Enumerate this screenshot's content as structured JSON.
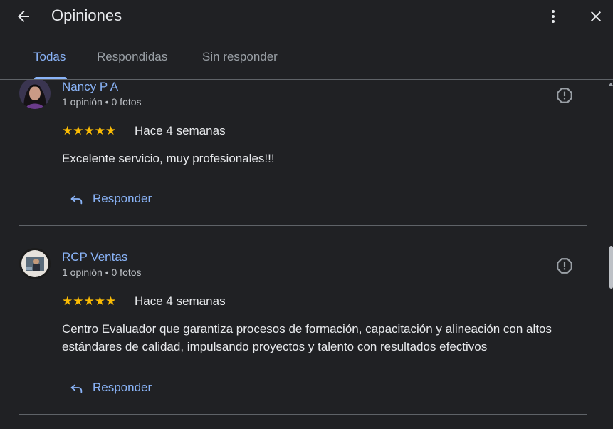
{
  "header": {
    "title": "Opiniones",
    "back_icon": "arrow-left-icon",
    "more_icon": "more-vert-icon",
    "close_icon": "close-icon"
  },
  "tabs": [
    {
      "label": "Todas",
      "active": true
    },
    {
      "label": "Respondidas",
      "active": false
    },
    {
      "label": "Sin responder",
      "active": false
    }
  ],
  "reviews": [
    {
      "name": "Nancy P A",
      "meta": "1 opinión • 0 fotos",
      "stars": "★★★★★",
      "rating": 5,
      "time": "Hace 4 semanas",
      "text": "Excelente servicio, muy profesionales!!!",
      "reply_label": "Responder"
    },
    {
      "name": "RCP Ventas",
      "meta": "1 opinión • 0 fotos",
      "stars": "★★★★★",
      "rating": 5,
      "time": "Hace 4 semanas",
      "text": "Centro Evaluador que garantiza procesos de formación, capacitación y alineación con altos estándares de calidad, impulsando proyectos y talento con resultados efectivos",
      "reply_label": "Responder"
    }
  ],
  "colors": {
    "background": "#202124",
    "accent": "#8ab4f8",
    "star": "#fbbc04",
    "divider": "#5f6368"
  }
}
